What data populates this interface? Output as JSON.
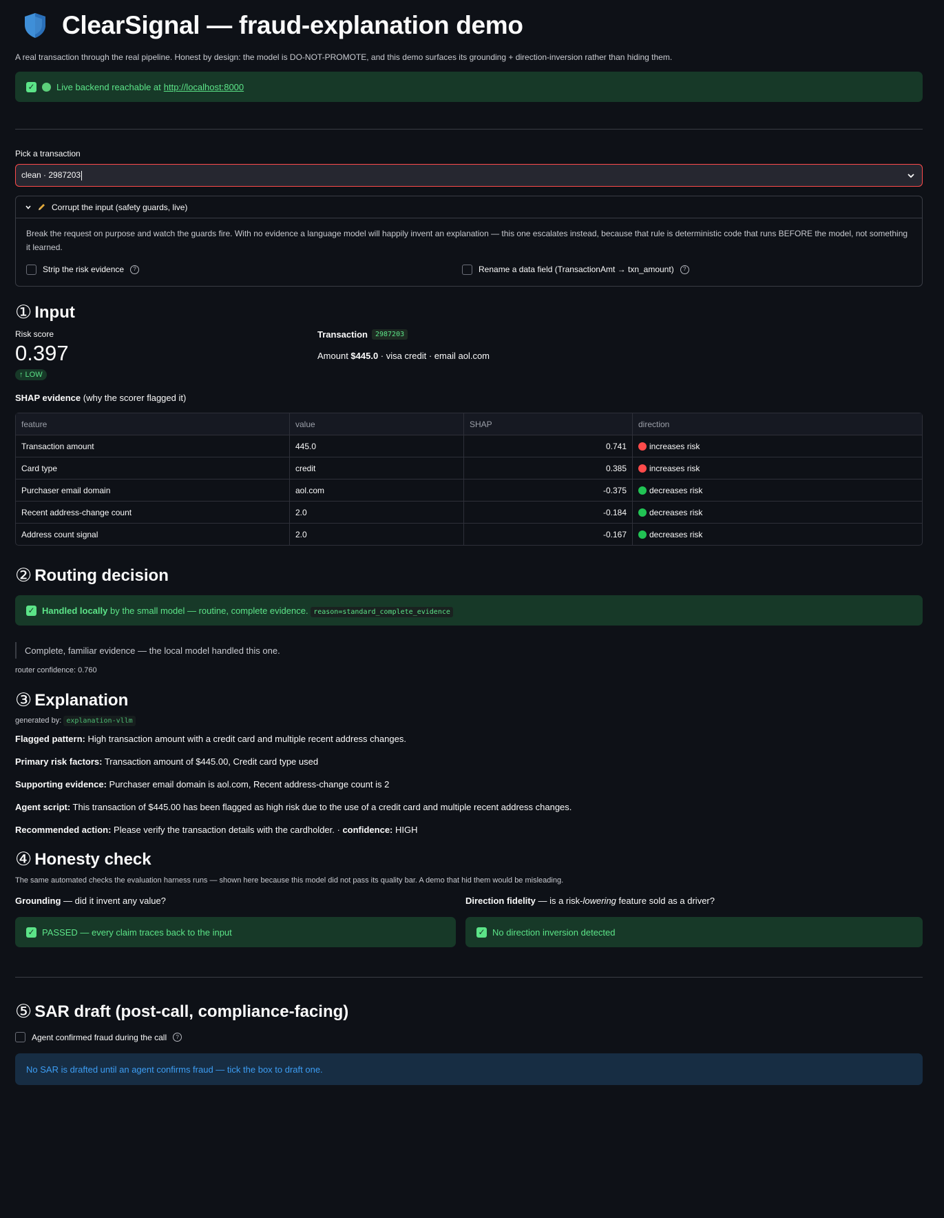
{
  "header": {
    "title": "ClearSignal — fraud-explanation demo",
    "subtitle": "A real transaction through the real pipeline. Honest by design: the model is DO-NOT-PROMOTE, and this demo surfaces its grounding + direction-inversion rather than hiding them."
  },
  "backend": {
    "text": "Live backend reachable at",
    "url": "http://localhost:8000"
  },
  "picker": {
    "label": "Pick a transaction",
    "value": "clean · 2987203"
  },
  "corrupt": {
    "title": "Corrupt the input (safety guards, live)",
    "body": "Break the request on purpose and watch the guards fire. With no evidence a language model will happily invent an explanation — this one escalates instead, because that rule is deterministic code that runs BEFORE the model, not something it learned.",
    "strip_label": "Strip the risk evidence",
    "rename_label": "Rename a data field (TransactionAmt → txn_amount)"
  },
  "input": {
    "number": "①",
    "heading": "Input",
    "risk_label": "Risk score",
    "risk_value": "0.397",
    "risk_badge": "↑ LOW",
    "txn_label": "Transaction",
    "txn_id": "2987203",
    "txn_amount_prefix": "Amount ",
    "txn_amount": "$445.0",
    "txn_rest": " · visa credit · email aol.com",
    "shap_title": "SHAP evidence",
    "shap_sub": " (why the scorer flagged it)",
    "columns": [
      "feature",
      "value",
      "SHAP",
      "direction"
    ],
    "rows": [
      {
        "feature": "Transaction amount",
        "value": "445.0",
        "shap": "0.741",
        "direction": "increases risk",
        "dir": "up"
      },
      {
        "feature": "Card type",
        "value": "credit",
        "shap": "0.385",
        "direction": "increases risk",
        "dir": "up"
      },
      {
        "feature": "Purchaser email domain",
        "value": "aol.com",
        "shap": "-0.375",
        "direction": "decreases risk",
        "dir": "down"
      },
      {
        "feature": "Recent address-change count",
        "value": "2.0",
        "shap": "-0.184",
        "direction": "decreases risk",
        "dir": "down"
      },
      {
        "feature": "Address count signal",
        "value": "2.0",
        "shap": "-0.167",
        "direction": "decreases risk",
        "dir": "down"
      }
    ]
  },
  "routing": {
    "number": "②",
    "heading": "Routing decision",
    "strong": "Handled locally",
    "text": " by the small model — routine, complete evidence.",
    "reason": "reason=standard_complete_evidence",
    "quote": "Complete, familiar evidence — the local model handled this one.",
    "confidence": "router confidence: 0.760"
  },
  "explanation": {
    "number": "③",
    "heading": "Explanation",
    "generated_by_label": "generated by:",
    "generated_by": "explanation-vllm",
    "lines": [
      {
        "label": "Flagged pattern:",
        "text": " High transaction amount with a credit card and multiple recent address changes."
      },
      {
        "label": "Primary risk factors:",
        "text": " Transaction amount of $445.00, Credit card type used"
      },
      {
        "label": "Supporting evidence:",
        "text": " Purchaser email domain is aol.com, Recent address-change count is 2"
      },
      {
        "label": "Agent script:",
        "text": " This transaction of $445.00 has been flagged as high risk due to the use of a credit card and multiple recent address changes."
      }
    ],
    "action_label": "Recommended action:",
    "action_text": " Please verify the transaction details with the cardholder. · ",
    "confidence_label": "confidence:",
    "confidence_value": " HIGH"
  },
  "honesty": {
    "number": "④",
    "heading": "Honesty check",
    "sub": "The same automated checks the evaluation harness runs — shown here because this model did not pass its quality bar. A demo that hid them would be misleading.",
    "grounding_label": "Grounding",
    "grounding_q": " — did it invent any value?",
    "grounding_result": "PASSED — every claim traces back to the input",
    "direction_label": "Direction fidelity",
    "direction_q1": " — is a risk-",
    "direction_q_em": "lowering",
    "direction_q2": " feature sold as a driver?",
    "direction_result": "No direction inversion detected"
  },
  "sar": {
    "number": "⑤",
    "heading": "SAR draft (post-call, compliance-facing)",
    "checkbox_label": "Agent confirmed fraud during the call",
    "info": "No SAR is drafted until an agent confirms fraud — tick the box to draft one."
  },
  "colors": {
    "bg": "#0e1117",
    "success_bg": "#173928",
    "success_text": "#5ce488",
    "info_bg": "#172d43",
    "info_text": "#3d9df3",
    "risk_up": "#ff4b4b",
    "risk_down": "#21c354"
  }
}
